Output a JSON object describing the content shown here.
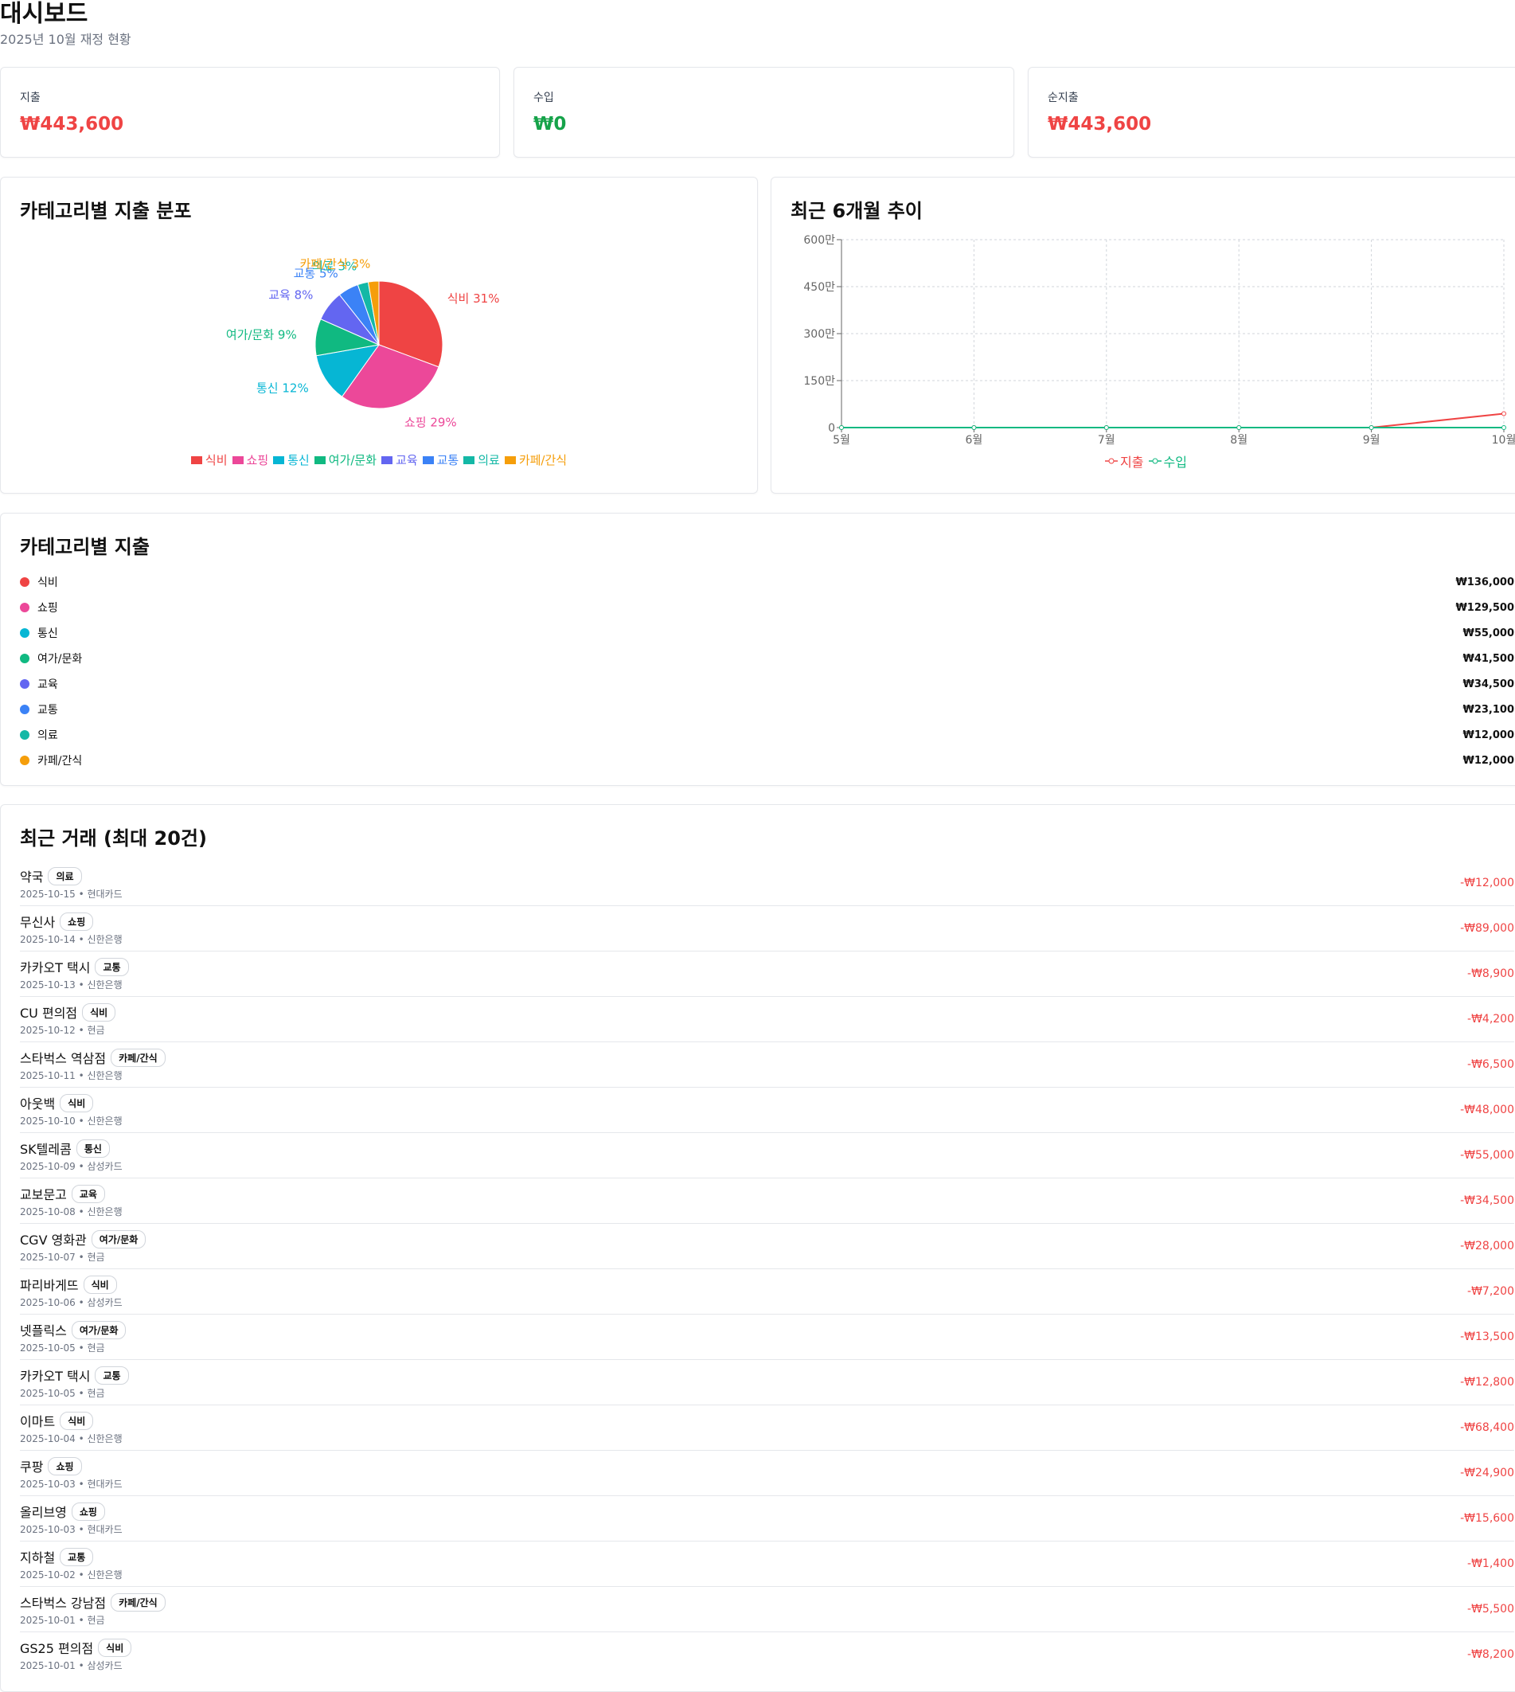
{
  "header": {
    "title": "대시보드",
    "subtitle": "2025년 10월 재정 현황"
  },
  "stats": [
    {
      "label": "지출",
      "value": "₩443,600",
      "tone": "red"
    },
    {
      "label": "수입",
      "value": "₩0",
      "tone": "green"
    },
    {
      "label": "순지출",
      "value": "₩443,600",
      "tone": "red"
    }
  ],
  "pie_card": {
    "title": "카테고리별 지출 분포"
  },
  "trend_card": {
    "title": "최근 6개월 추이"
  },
  "category_card": {
    "title": "카테고리별 지출",
    "items": [
      {
        "name": "식비",
        "amount": "₩136,000",
        "color": "#ef4444"
      },
      {
        "name": "쇼핑",
        "amount": "₩129,500",
        "color": "#ec4899"
      },
      {
        "name": "통신",
        "amount": "₩55,000",
        "color": "#06b6d4"
      },
      {
        "name": "여가/문화",
        "amount": "₩41,500",
        "color": "#10b981"
      },
      {
        "name": "교육",
        "amount": "₩34,500",
        "color": "#6366f1"
      },
      {
        "name": "교통",
        "amount": "₩23,100",
        "color": "#3b82f6"
      },
      {
        "name": "의료",
        "amount": "₩12,000",
        "color": "#14b8a6"
      },
      {
        "name": "카페/간식",
        "amount": "₩12,000",
        "color": "#f59e0b"
      }
    ]
  },
  "transactions_card": {
    "title": "최근 거래 (최대 20건)",
    "items": [
      {
        "name": "약국",
        "category": "의료",
        "date": "2025-10-15",
        "account": "현대카드",
        "amount": "-₩12,000"
      },
      {
        "name": "무신사",
        "category": "쇼핑",
        "date": "2025-10-14",
        "account": "신한은행",
        "amount": "-₩89,000"
      },
      {
        "name": "카카오T 택시",
        "category": "교통",
        "date": "2025-10-13",
        "account": "신한은행",
        "amount": "-₩8,900"
      },
      {
        "name": "CU 편의점",
        "category": "식비",
        "date": "2025-10-12",
        "account": "현금",
        "amount": "-₩4,200"
      },
      {
        "name": "스타벅스 역삼점",
        "category": "카페/간식",
        "date": "2025-10-11",
        "account": "신한은행",
        "amount": "-₩6,500"
      },
      {
        "name": "아웃백",
        "category": "식비",
        "date": "2025-10-10",
        "account": "신한은행",
        "amount": "-₩48,000"
      },
      {
        "name": "SK텔레콤",
        "category": "통신",
        "date": "2025-10-09",
        "account": "삼성카드",
        "amount": "-₩55,000"
      },
      {
        "name": "교보문고",
        "category": "교육",
        "date": "2025-10-08",
        "account": "신한은행",
        "amount": "-₩34,500"
      },
      {
        "name": "CGV 영화관",
        "category": "여가/문화",
        "date": "2025-10-07",
        "account": "현금",
        "amount": "-₩28,000"
      },
      {
        "name": "파리바게뜨",
        "category": "식비",
        "date": "2025-10-06",
        "account": "삼성카드",
        "amount": "-₩7,200"
      },
      {
        "name": "넷플릭스",
        "category": "여가/문화",
        "date": "2025-10-05",
        "account": "현금",
        "amount": "-₩13,500"
      },
      {
        "name": "카카오T 택시",
        "category": "교통",
        "date": "2025-10-05",
        "account": "현금",
        "amount": "-₩12,800"
      },
      {
        "name": "이마트",
        "category": "식비",
        "date": "2025-10-04",
        "account": "신한은행",
        "amount": "-₩68,400"
      },
      {
        "name": "쿠팡",
        "category": "쇼핑",
        "date": "2025-10-03",
        "account": "현대카드",
        "amount": "-₩24,900"
      },
      {
        "name": "올리브영",
        "category": "쇼핑",
        "date": "2025-10-03",
        "account": "현대카드",
        "amount": "-₩15,600"
      },
      {
        "name": "지하철",
        "category": "교통",
        "date": "2025-10-02",
        "account": "신한은행",
        "amount": "-₩1,400"
      },
      {
        "name": "스타벅스 강남점",
        "category": "카페/간식",
        "date": "2025-10-01",
        "account": "현금",
        "amount": "-₩5,500"
      },
      {
        "name": "GS25 편의점",
        "category": "식비",
        "date": "2025-10-01",
        "account": "삼성카드",
        "amount": "-₩8,200"
      }
    ]
  },
  "chart_data": [
    {
      "type": "pie",
      "categories": [
        "식비",
        "쇼핑",
        "통신",
        "여가/문화",
        "교육",
        "교통",
        "의료",
        "카페/간식"
      ],
      "values": [
        136000,
        129500,
        55000,
        41500,
        34500,
        23100,
        12000,
        12000
      ],
      "percent_labels": [
        "식비 31%",
        "쇼핑 29%",
        "통신 12%",
        "여가/문화 9%",
        "교육 8%",
        "교통 5%",
        "의료 3%",
        "카페/간식 3%"
      ],
      "colors": [
        "#ef4444",
        "#ec4899",
        "#06b6d4",
        "#10b981",
        "#6366f1",
        "#3b82f6",
        "#14b8a6",
        "#f59e0b"
      ],
      "legend": "bottom"
    },
    {
      "type": "line",
      "x": [
        "5월",
        "6월",
        "7월",
        "8월",
        "9월",
        "10월"
      ],
      "y_ticks": [
        "0",
        "150만",
        "300만",
        "450만",
        "600만"
      ],
      "ylim": [
        0,
        6000000
      ],
      "grid": true,
      "legend": "bottom",
      "series": [
        {
          "name": "지출",
          "color": "#ef4444",
          "values": [
            0,
            0,
            0,
            0,
            0,
            443600
          ]
        },
        {
          "name": "수입",
          "color": "#10b981",
          "values": [
            0,
            0,
            0,
            0,
            0,
            0
          ]
        }
      ]
    }
  ]
}
